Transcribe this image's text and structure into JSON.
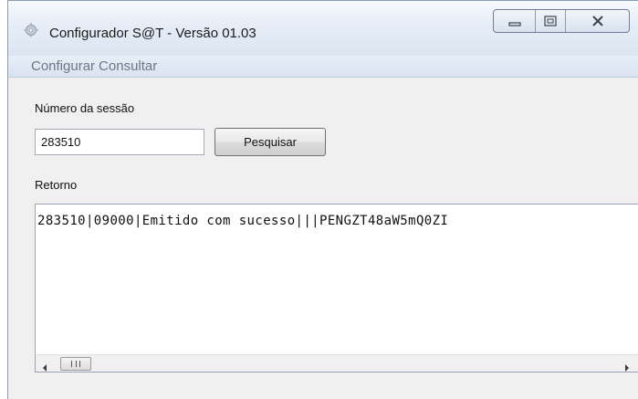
{
  "window": {
    "title": "Configurador S@T - Versão 01.03",
    "icons": {
      "app": "gear-icon",
      "minimize": "minimize-icon",
      "maximize": "maximize-icon",
      "close": "close-icon"
    }
  },
  "menubar": {
    "items": [
      {
        "label": "Configurar"
      },
      {
        "label": "Consultar"
      }
    ]
  },
  "form": {
    "session_label": "Número da sessão",
    "session_value": "283510",
    "search_button": "Pesquisar",
    "retorno_label": "Retorno",
    "retorno_value": "283510|09000|Emitido com sucesso|||PENGZT48aW5mQ0ZI"
  },
  "scrollbar": {
    "left_arrow": "arrow-left-icon",
    "right_arrow": "arrow-right-icon"
  },
  "colors": {
    "titlebar": "#dbe5f1",
    "menubar_text": "#6b7689",
    "client_bg": "#f0f0f0"
  }
}
